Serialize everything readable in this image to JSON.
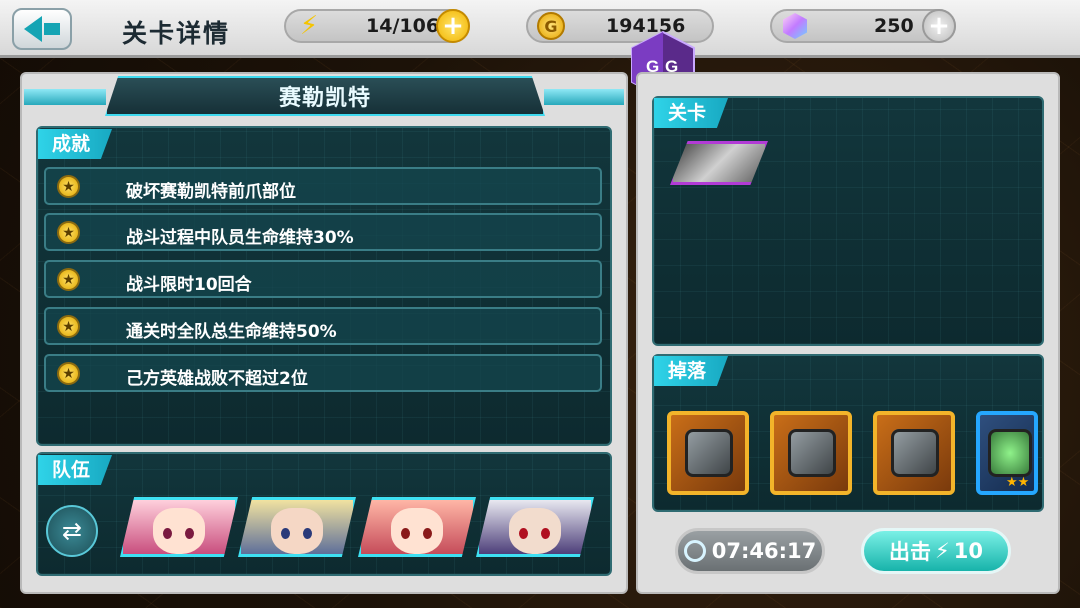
{
  "header": {
    "title": "关卡详情",
    "energy": "14/106",
    "gold": "194156",
    "gems": "250",
    "energy_icon": "lightning-icon",
    "gold_icon": "coin-icon",
    "gem_icon": "gem-icon",
    "gg_logo": "GG"
  },
  "stage": {
    "name": "赛勒凯特"
  },
  "achievements": {
    "label": "成就",
    "items": [
      "破坏赛勒凯特前爪部位",
      "战斗过程中队员生命维持30%",
      "战斗限时10回合",
      "通关时全队总生命维持50%",
      "己方英雄战败不超过2位"
    ]
  },
  "team": {
    "label": "队伍"
  },
  "level": {
    "label": "关卡"
  },
  "drops": {
    "label": "掉落",
    "blue_item_stars": "★★"
  },
  "actions": {
    "timer": "07:46:17",
    "go_label": "出击",
    "go_cost": "10"
  },
  "colors": {
    "accent_cyan": "#2fd3e8",
    "gold": "#f3b42a",
    "panel_dark": "#0d2a2f"
  }
}
